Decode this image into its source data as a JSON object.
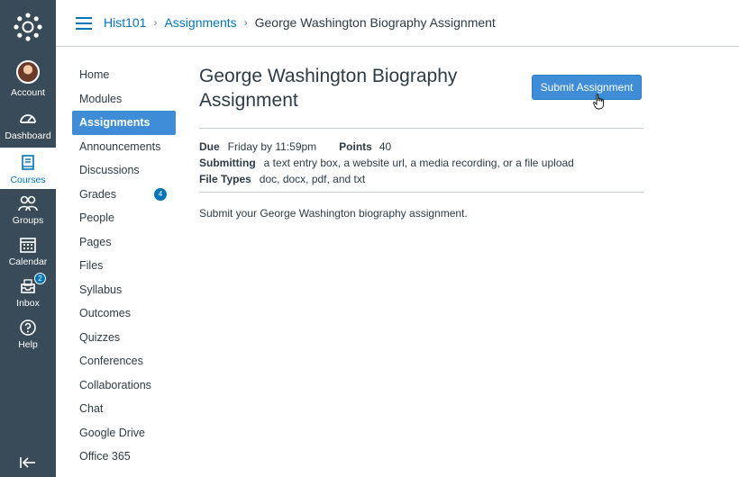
{
  "global_nav": {
    "items": [
      {
        "label": "Account",
        "icon": "account-avatar"
      },
      {
        "label": "Dashboard",
        "icon": "dashboard-icon"
      },
      {
        "label": "Courses",
        "icon": "courses-icon",
        "active": true
      },
      {
        "label": "Groups",
        "icon": "groups-icon"
      },
      {
        "label": "Calendar",
        "icon": "calendar-icon"
      },
      {
        "label": "Inbox",
        "icon": "inbox-icon",
        "badge": "2"
      },
      {
        "label": "Help",
        "icon": "help-icon"
      }
    ]
  },
  "breadcrumb": {
    "course": "Hist101",
    "section": "Assignments",
    "current": "George Washington Biography Assignment"
  },
  "course_nav": {
    "items": [
      {
        "label": "Home"
      },
      {
        "label": "Modules"
      },
      {
        "label": "Assignments",
        "active": true
      },
      {
        "label": "Announcements"
      },
      {
        "label": "Discussions"
      },
      {
        "label": "Grades",
        "badge": "4"
      },
      {
        "label": "People"
      },
      {
        "label": "Pages"
      },
      {
        "label": "Files"
      },
      {
        "label": "Syllabus"
      },
      {
        "label": "Outcomes"
      },
      {
        "label": "Quizzes"
      },
      {
        "label": "Conferences"
      },
      {
        "label": "Collaborations"
      },
      {
        "label": "Chat"
      },
      {
        "label": "Google Drive"
      },
      {
        "label": "Office 365"
      }
    ]
  },
  "assignment": {
    "title": "George Washington Biography Assignment",
    "submit_label": "Submit Assignment",
    "due_label": "Due",
    "due_value": "Friday by 11:59pm",
    "points_label": "Points",
    "points_value": "40",
    "submitting_label": "Submitting",
    "submitting_value": "a text entry box, a website url, a media recording, or a file upload",
    "file_types_label": "File Types",
    "file_types_value": "doc, docx, pdf, and txt",
    "description": "Submit your George Washington biography assignment."
  },
  "colors": {
    "nav_bg": "#394b58",
    "brand_blue": "#0374b5",
    "button_blue": "#3e8dd6",
    "text": "#2d3b45"
  }
}
